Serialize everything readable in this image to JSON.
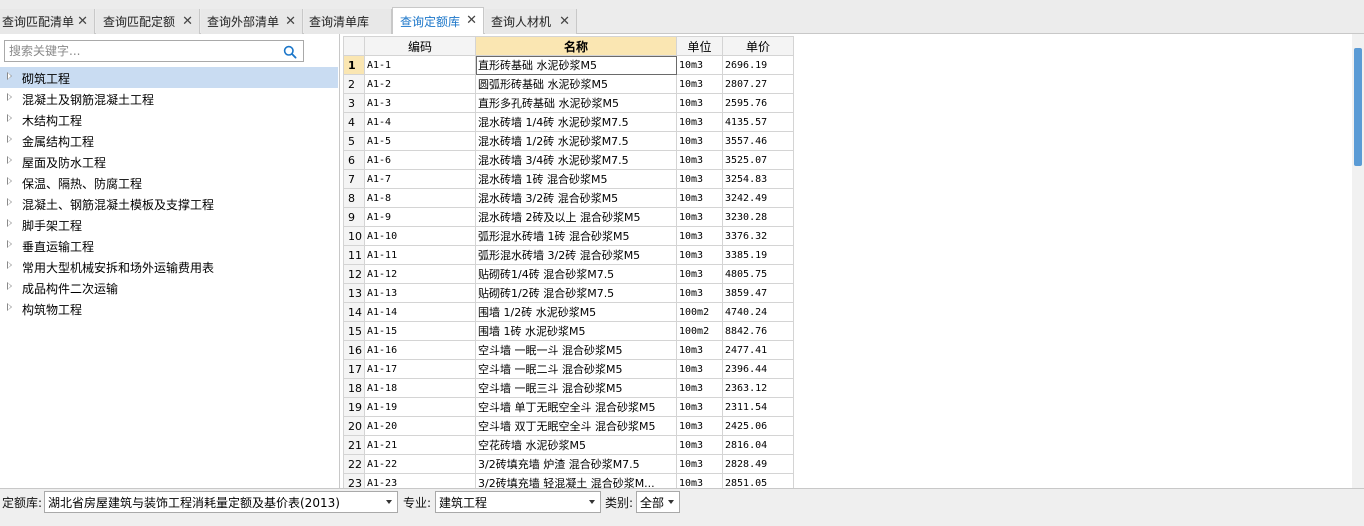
{
  "tabs": [
    {
      "label": "查询匹配清单",
      "active": false
    },
    {
      "label": "查询匹配定额",
      "active": false
    },
    {
      "label": "查询外部清单",
      "active": false
    },
    {
      "label": "查询清单库",
      "active": false
    },
    {
      "label": "查询定额库",
      "active": true
    },
    {
      "label": "查询人材机",
      "active": false
    }
  ],
  "tab_close_glyph": "✕",
  "search": {
    "placeholder": "搜索关键字...",
    "icon": "search-icon"
  },
  "tree": [
    {
      "label": "砌筑工程",
      "selected": true
    },
    {
      "label": "混凝土及钢筋混凝土工程",
      "selected": false
    },
    {
      "label": "木结构工程",
      "selected": false
    },
    {
      "label": "金属结构工程",
      "selected": false
    },
    {
      "label": "屋面及防水工程",
      "selected": false
    },
    {
      "label": "保温、隔热、防腐工程",
      "selected": false
    },
    {
      "label": "混凝土、钢筋混凝土模板及支撑工程",
      "selected": false
    },
    {
      "label": "脚手架工程",
      "selected": false
    },
    {
      "label": "垂直运输工程",
      "selected": false
    },
    {
      "label": "常用大型机械安拆和场外运输费用表",
      "selected": false
    },
    {
      "label": "成品构件二次运输",
      "selected": false
    },
    {
      "label": "构筑物工程",
      "selected": false
    }
  ],
  "grid": {
    "headers": {
      "rownum": "",
      "code": "编码",
      "name": "名称",
      "unit": "单位",
      "price": "单价"
    },
    "rows": [
      {
        "n": "1",
        "code": "A1-1",
        "name": "直形砖基础 水泥砂浆M5",
        "unit": "10m3",
        "price": "2696.19"
      },
      {
        "n": "2",
        "code": "A1-2",
        "name": "圆弧形砖基础 水泥砂浆M5",
        "unit": "10m3",
        "price": "2807.27"
      },
      {
        "n": "3",
        "code": "A1-3",
        "name": "直形多孔砖基础 水泥砂浆M5",
        "unit": "10m3",
        "price": "2595.76"
      },
      {
        "n": "4",
        "code": "A1-4",
        "name": "混水砖墙 1/4砖 水泥砂浆M7.5",
        "unit": "10m3",
        "price": "4135.57"
      },
      {
        "n": "5",
        "code": "A1-5",
        "name": "混水砖墙 1/2砖 水泥砂浆M7.5",
        "unit": "10m3",
        "price": "3557.46"
      },
      {
        "n": "6",
        "code": "A1-6",
        "name": "混水砖墙 3/4砖 水泥砂浆M7.5",
        "unit": "10m3",
        "price": "3525.07"
      },
      {
        "n": "7",
        "code": "A1-7",
        "name": "混水砖墙 1砖 混合砂浆M5",
        "unit": "10m3",
        "price": "3254.83"
      },
      {
        "n": "8",
        "code": "A1-8",
        "name": "混水砖墙 3/2砖 混合砂浆M5",
        "unit": "10m3",
        "price": "3242.49"
      },
      {
        "n": "9",
        "code": "A1-9",
        "name": "混水砖墙 2砖及以上 混合砂浆M5",
        "unit": "10m3",
        "price": "3230.28"
      },
      {
        "n": "10",
        "code": "A1-10",
        "name": "弧形混水砖墙 1砖 混合砂浆M5",
        "unit": "10m3",
        "price": "3376.32"
      },
      {
        "n": "11",
        "code": "A1-11",
        "name": "弧形混水砖墙 3/2砖 混合砂浆M5",
        "unit": "10m3",
        "price": "3385.19"
      },
      {
        "n": "12",
        "code": "A1-12",
        "name": "贴砌砖1/4砖 混合砂浆M7.5",
        "unit": "10m3",
        "price": "4805.75"
      },
      {
        "n": "13",
        "code": "A1-13",
        "name": "贴砌砖1/2砖 混合砂浆M7.5",
        "unit": "10m3",
        "price": "3859.47"
      },
      {
        "n": "14",
        "code": "A1-14",
        "name": "围墙 1/2砖 水泥砂浆M5",
        "unit": "100m2",
        "price": "4740.24"
      },
      {
        "n": "15",
        "code": "A1-15",
        "name": "围墙 1砖 水泥砂浆M5",
        "unit": "100m2",
        "price": "8842.76"
      },
      {
        "n": "16",
        "code": "A1-16",
        "name": "空斗墙 一眠一斗 混合砂浆M5",
        "unit": "10m3",
        "price": "2477.41"
      },
      {
        "n": "17",
        "code": "A1-17",
        "name": "空斗墙 一眠二斗 混合砂浆M5",
        "unit": "10m3",
        "price": "2396.44"
      },
      {
        "n": "18",
        "code": "A1-18",
        "name": "空斗墙 一眠三斗 混合砂浆M5",
        "unit": "10m3",
        "price": "2363.12"
      },
      {
        "n": "19",
        "code": "A1-19",
        "name": "空斗墙 单丁无眠空全斗 混合砂浆M5",
        "unit": "10m3",
        "price": "2311.54"
      },
      {
        "n": "20",
        "code": "A1-20",
        "name": "空斗墙 双丁无眠空全斗 混合砂浆M5",
        "unit": "10m3",
        "price": "2425.06"
      },
      {
        "n": "21",
        "code": "A1-21",
        "name": "空花砖墙 水泥砂浆M5",
        "unit": "10m3",
        "price": "2816.04"
      },
      {
        "n": "22",
        "code": "A1-22",
        "name": "3/2砖填充墙 炉渣 混合砂浆M7.5",
        "unit": "10m3",
        "price": "2828.49"
      },
      {
        "n": "23",
        "code": "A1-23",
        "name": "3/2砖填充墙 轻混凝土 混合砂浆M...",
        "unit": "10m3",
        "price": "2851.05"
      }
    ]
  },
  "bottom": {
    "quota_label": "定额库:",
    "quota_value": "湖北省房屋建筑与装饰工程消耗量定额及基价表(2013)",
    "major_label": "专业:",
    "major_value": "建筑工程",
    "category_label": "类别:",
    "category_value": "全部"
  },
  "colors": {
    "accent": "#1b76c9",
    "header_highlight": "#fae6b2",
    "selection": "#c9dcf2",
    "scroll_thumb": "#5b9bd5"
  }
}
